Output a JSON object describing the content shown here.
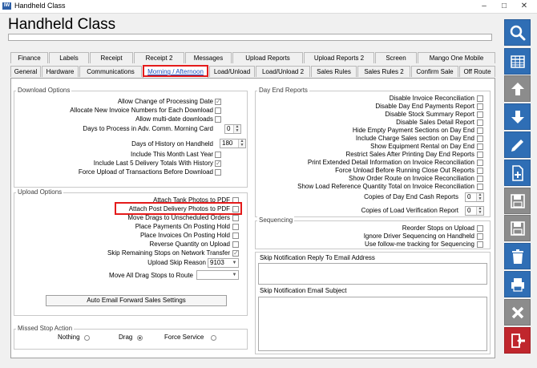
{
  "window": {
    "title": "Handheld Class",
    "app_icon_text": "IW"
  },
  "header": {
    "title": "Handheld Class"
  },
  "tabs_row1": [
    "Finance",
    "Labels",
    "Receipt",
    "Receipt 2",
    "Messages",
    "Upload Reports",
    "Upload Reports 2",
    "Screen",
    "Mango One Mobile"
  ],
  "tabs_row2": [
    "General",
    "Hardware",
    "Communications",
    "Morning / Afternoon",
    "Load/Unload",
    "Load/Unload 2",
    "Sales Rules",
    "Sales Rules 2",
    "Confirm Sale",
    "Off Route"
  ],
  "active_tab": "Morning / Afternoon",
  "download": {
    "legend": "Download Options",
    "allow_change_date": "Allow Change of Processing Date",
    "allocate_invoice": "Allocate New Invoice Numbers for Each Download",
    "allow_multi_date": "Allow multi-date downloads",
    "days_adv_label": "Days to Process in Adv. Comm. Morning Card",
    "days_adv_value": "0",
    "days_history_label": "Days of History on Handheld",
    "days_history_value": "180",
    "include_month": "Include This Month Last Year",
    "include_last5": "Include Last 5 Delivery Totals With History",
    "force_upload": "Force Upload of Transactions Before Download"
  },
  "upload": {
    "legend": "Upload Options",
    "attach_tank": "Attach Tank Photos to PDF",
    "attach_post": "Attach Post Delivery Photos to PDF",
    "move_drags": "Move Drags to Unscheduled Orders",
    "place_payments": "Place Payments On Posting Hold",
    "place_invoices": "Place Invoices On Posting Hold",
    "reverse_qty": "Reverse Quantity on Upload",
    "skip_remaining": "Skip Remaining Stops on Network Transfer",
    "skip_reason_label": "Upload Skip Reason",
    "skip_reason_value": "9103",
    "move_drag_stops": "Move All Drag Stops to Route",
    "auto_email_button": "Auto Email Forward Sales Settings"
  },
  "missed": {
    "legend": "Missed Stop Action",
    "nothing": "Nothing",
    "drag": "Drag",
    "force": "Force Service"
  },
  "dayend": {
    "legend": "Day End Reports",
    "items": [
      "Disable Invoice Reconciliation",
      "Disable Day End Payments Report",
      "Disable Stock Summary Report",
      "Disable Sales Detail Report",
      "Hide Empty Payment Sections on Day End",
      "Include Charge Sales section on Day End",
      "Show Equipment Rental on Day End",
      "Restrict Sales After Printing Day End Reports",
      "Print Extended Detail Information on Invoice Reconciliation",
      "Force Unload Before Running Close Out Reports",
      "Show Order Route on Invoice Reconciliation",
      "Show Load Reference Quantity Total on Invoice Reconciliation"
    ],
    "copies_cash_label": "Copies of Day End Cash Reports",
    "copies_cash_value": "0",
    "copies_load_label": "Copies of Load Verification Report",
    "copies_load_value": "0"
  },
  "sequencing": {
    "legend": "Sequencing",
    "reorder": "Reorder Stops on Upload",
    "ignore": "Ignore Driver Sequencing on Handheld",
    "follow": "Use follow-me tracking for Sequencing"
  },
  "skip_email": {
    "reply_label": "Skip Notification Reply To Email Address",
    "subject_label": "Skip Notification Email Subject"
  },
  "sidebar": [
    "search-icon",
    "grid-icon",
    "arrow-up-icon",
    "arrow-down-icon",
    "edit-icon",
    "new-document-icon",
    "save-copy-icon",
    "save-icon",
    "delete-icon",
    "print-icon",
    "close-icon",
    "exit-icon"
  ],
  "colors": {
    "sidebar_blue": "#2f6eb5",
    "sidebar_gray": "#8c8c8c",
    "sidebar_red": "#c0262d",
    "highlight_red": "#e41b1b"
  }
}
